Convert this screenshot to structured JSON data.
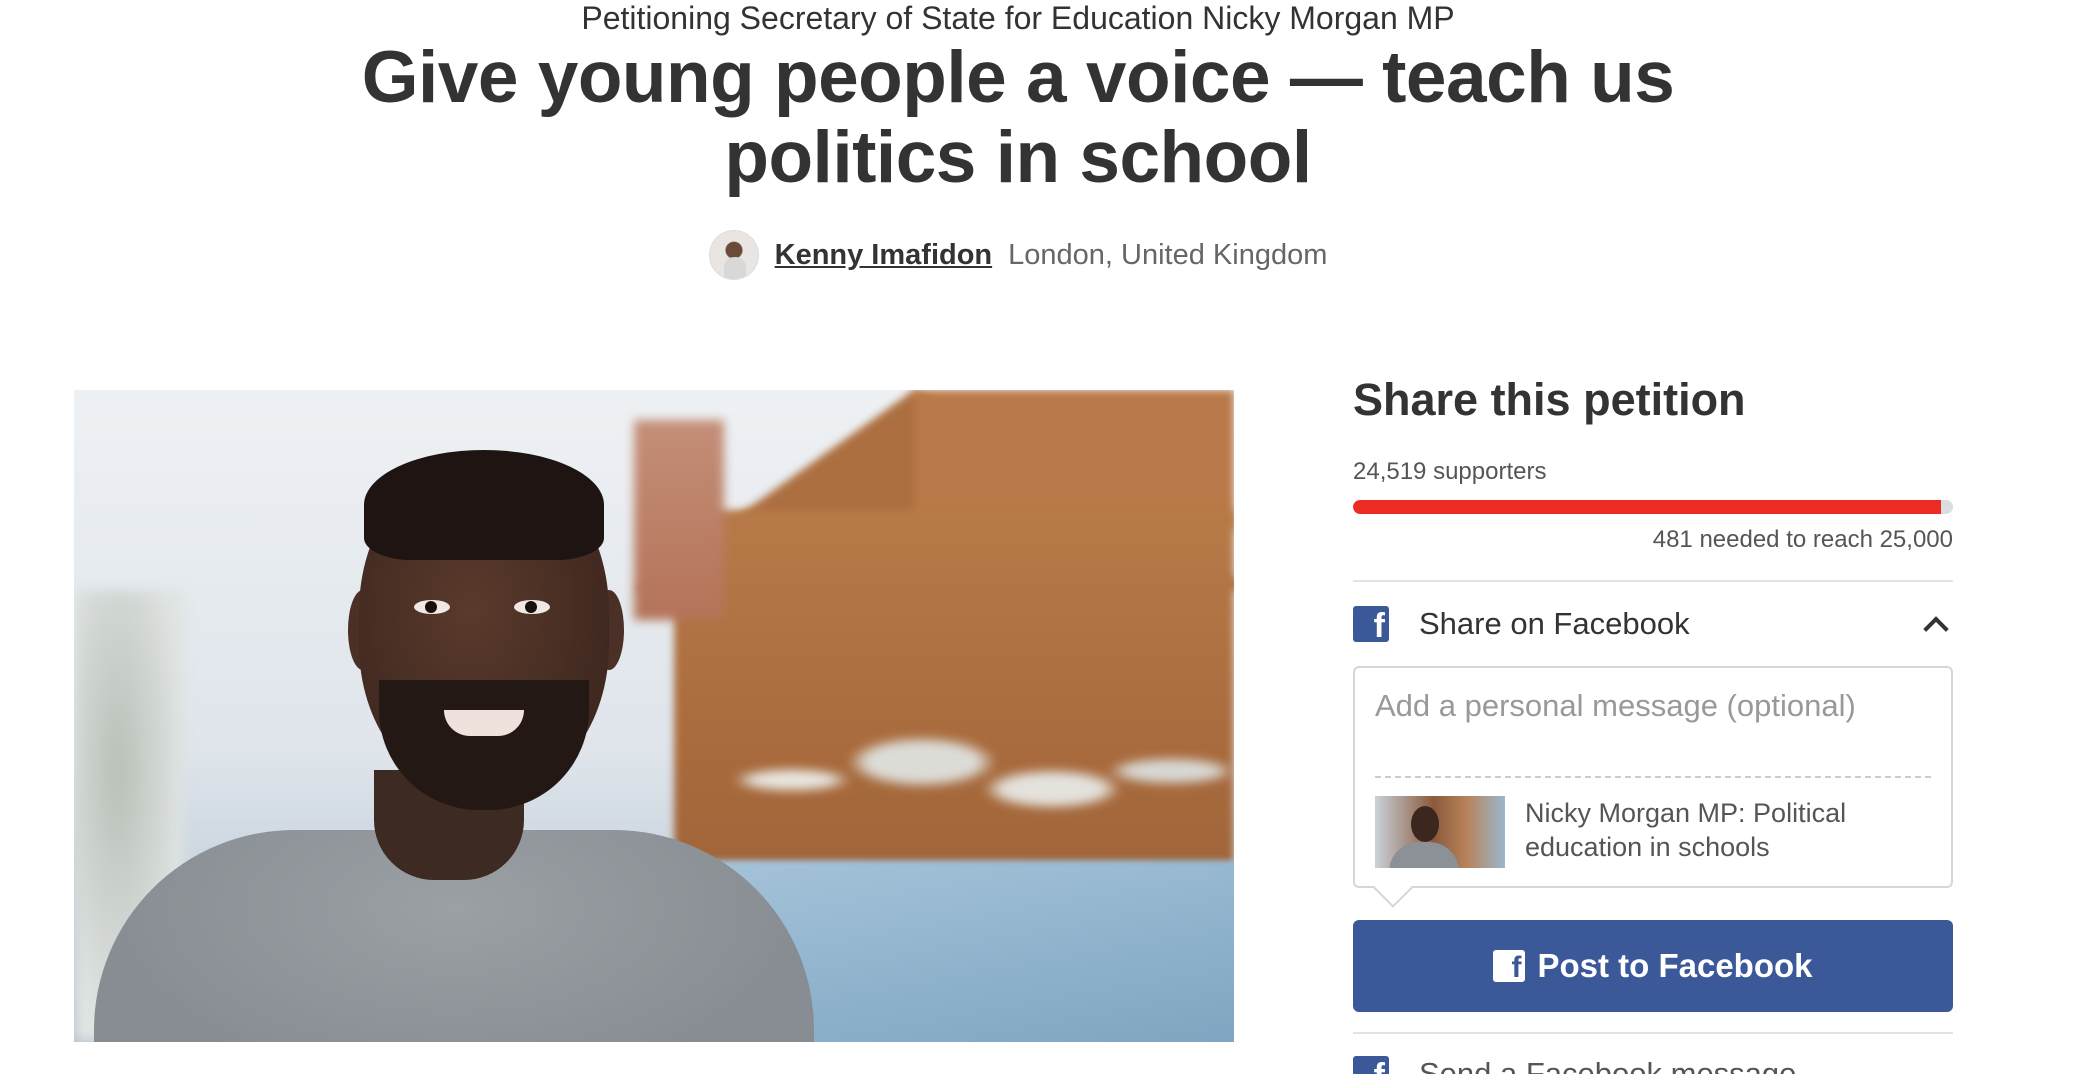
{
  "petition": {
    "targeting": "Petitioning Secretary of State for Education Nicky Morgan MP",
    "title": "Give young people a voice — teach us politics in school",
    "starter_name": "Kenny Imafidon",
    "starter_location": "London, United Kingdom"
  },
  "share": {
    "title": "Share this petition",
    "supporters": "24,519 supporters",
    "progress_fraction": 0.98,
    "needed": "481 needed to reach 25,000",
    "facebook_label": "Share on Facebook",
    "message_placeholder": "Add a personal message (optional)",
    "preview_text": "Nicky Morgan MP: Political education in schools",
    "post_button": "Post to Facebook",
    "next_option": "Send a Facebook message"
  },
  "icons": {
    "facebook": "facebook-icon",
    "chevron": "chevron-up-icon"
  },
  "colors": {
    "progress": "#ec2c22",
    "facebook": "#3b5998"
  }
}
